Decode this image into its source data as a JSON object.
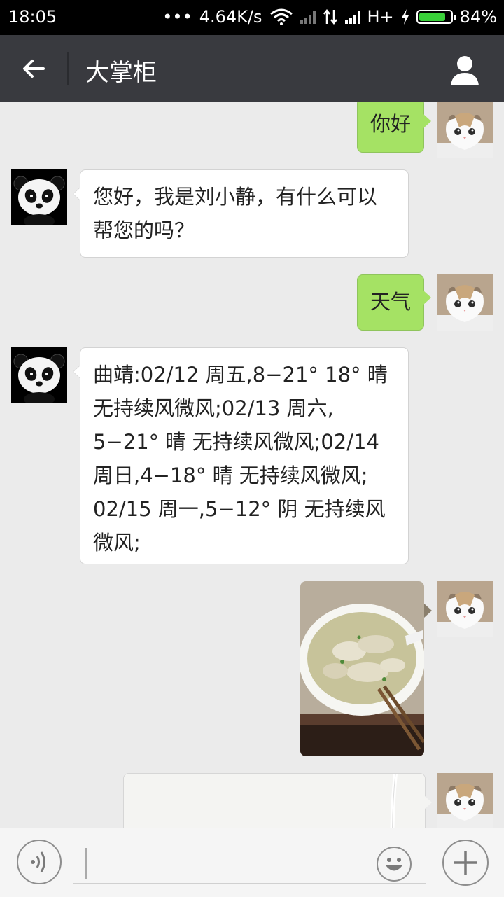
{
  "status_bar": {
    "time": "18:05",
    "dots": "•••",
    "net_speed": "4.64K/s",
    "network": "H+",
    "battery": "84%",
    "battery_level": 0.84
  },
  "header": {
    "title": "大掌柜"
  },
  "messages": [
    {
      "from": "me",
      "text": "你好"
    },
    {
      "from": "bot",
      "text": "您好，我是刘小静，有什么可以帮您的吗？"
    },
    {
      "from": "me",
      "text": "天气"
    },
    {
      "from": "bot",
      "text": "曲靖:02/12 周五,8−21° 18° 晴 无持续风微风;02/13 周六, 5−21° 晴 无持续风微风;02/14 周日,4−18° 晴 无持续风微风; 02/15 周一,5−12° 阴 无持续风微风;"
    },
    {
      "from": "me",
      "type": "image",
      "subject": "dumplings-soup-photo"
    },
    {
      "from": "me",
      "type": "location",
      "subject": "map-location"
    }
  ],
  "icons": {
    "back": "arrow-left-icon",
    "profile": "person-icon",
    "voice": "voice-icon",
    "emoji": "emoji-icon",
    "more": "plus-icon"
  },
  "colors": {
    "header_bg": "#393a3f",
    "outgoing_bubble": "#a5e264",
    "incoming_bubble": "#ffffff",
    "chat_bg": "#ebebeb"
  }
}
